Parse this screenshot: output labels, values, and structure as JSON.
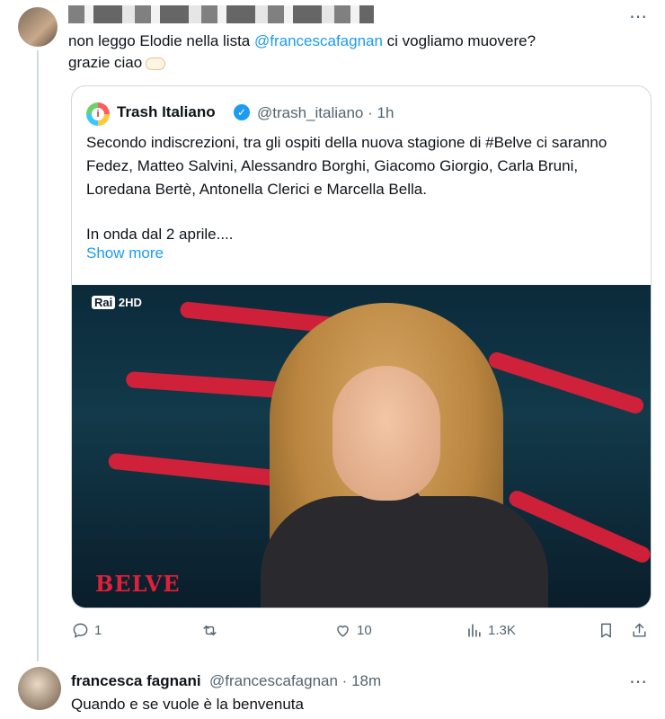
{
  "tweet": {
    "text_before": "non leggo Elodie nella lista ",
    "mention": "@francescafagnan",
    "text_after": " ci vogliamo muovere?",
    "line2": "grazie ciao",
    "more_icon": "⋯"
  },
  "quote": {
    "name": "Trash Italiano",
    "handle_time": "@trash_italiano · 1h",
    "body_p1": "Secondo indiscrezioni, tra gli ospiti della nuova stagione di #Belve ci saranno Fedez, Matteo Salvini, Alessandro Borghi, Giacomo Giorgio, Carla Bruni, Loredana Bertè, Antonella Clerici e Marcella Bella.",
    "body_p2": "In onda dal 2 aprile....",
    "show_more": "Show more",
    "media": {
      "channel_a": "Rai",
      "channel_b": "2HD",
      "show_logo": "BELVE"
    }
  },
  "actions": {
    "replies": "1",
    "retweets": "",
    "likes": "10",
    "views": "1.3K"
  },
  "reply": {
    "name": "francesca fagnani",
    "handle_time": "@francescafagnan · 18m",
    "text": "Quando e se vuole è la benvenuta",
    "more_icon": "⋯"
  },
  "colors": {
    "accent": "#1d9bf0",
    "muted": "#536471",
    "border": "#cfd9de",
    "belve_red": "#e0203a"
  }
}
